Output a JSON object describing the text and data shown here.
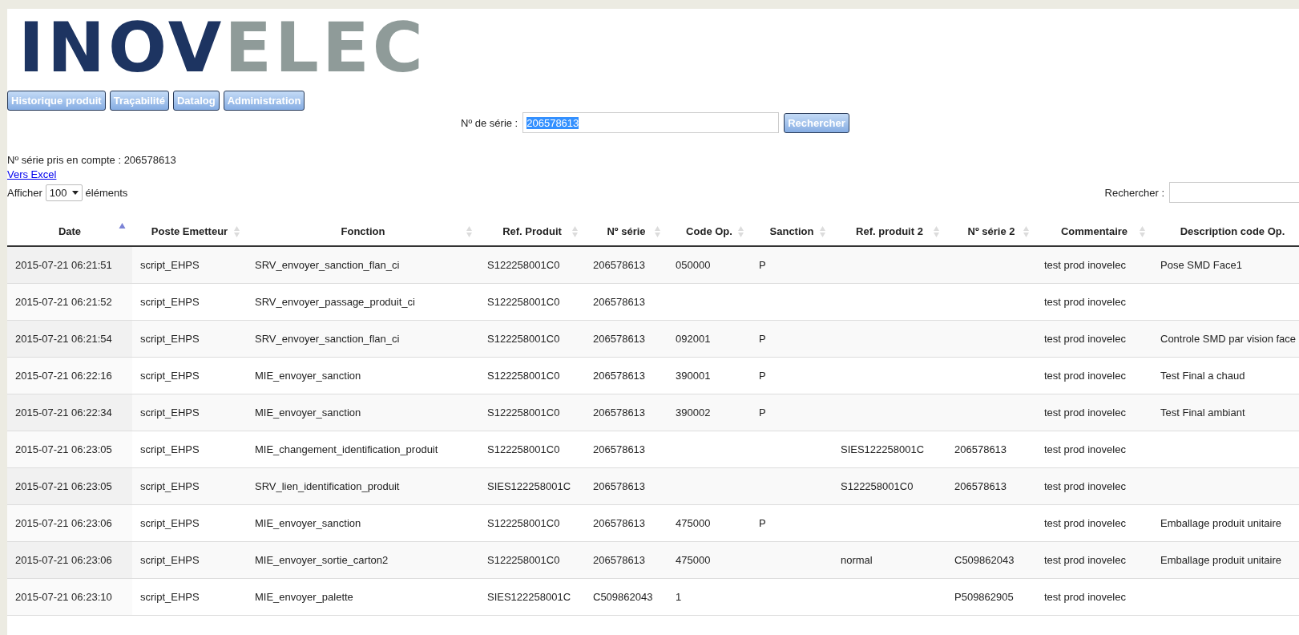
{
  "logo": {
    "first": "INOV",
    "second": "ELEC"
  },
  "nav_tabs": [
    {
      "label": "Historique produit"
    },
    {
      "label": "Traçabilité"
    },
    {
      "label": "Datalog"
    },
    {
      "label": "Administration"
    }
  ],
  "search": {
    "label": "Nº de série :",
    "value": "206578613",
    "value_selected": true,
    "button": "Rechercher"
  },
  "serial_info": "Nº série pris en compte : 206578613",
  "export_link": "Vers Excel",
  "page_length": {
    "prefix": "Afficher",
    "value": "100",
    "suffix": "éléments"
  },
  "filter": {
    "label": "Rechercher :"
  },
  "table": {
    "columns": [
      {
        "label": "Date",
        "sorted": true
      },
      {
        "label": "Poste Emetteur",
        "sorted": false
      },
      {
        "label": "Fonction",
        "sorted": false
      },
      {
        "label": "Ref. Produit",
        "sorted": false
      },
      {
        "label": "Nº série",
        "sorted": false
      },
      {
        "label": "Code Op.",
        "sorted": false
      },
      {
        "label": "Sanction",
        "sorted": false
      },
      {
        "label": "Ref. produit 2",
        "sorted": false
      },
      {
        "label": "Nº série 2",
        "sorted": false
      },
      {
        "label": "Commentaire",
        "sorted": false
      },
      {
        "label": "Description code Op."
      }
    ],
    "rows": [
      [
        "2015-07-21 06:21:51",
        "script_EHPS",
        "SRV_envoyer_sanction_flan_ci",
        "S122258001C0",
        "206578613",
        "050000",
        "P",
        null,
        null,
        "test prod inovelec",
        "Pose SMD Face1"
      ],
      [
        "2015-07-21 06:21:52",
        "script_EHPS",
        "SRV_envoyer_passage_produit_ci",
        "S122258001C0",
        "206578613",
        null,
        null,
        null,
        null,
        "test prod inovelec",
        null
      ],
      [
        "2015-07-21 06:21:54",
        "script_EHPS",
        "SRV_envoyer_sanction_flan_ci",
        "S122258001C0",
        "206578613",
        "092001",
        "P",
        null,
        null,
        "test prod inovelec",
        "Controle SMD par vision face"
      ],
      [
        "2015-07-21 06:22:16",
        "script_EHPS",
        "MIE_envoyer_sanction",
        "S122258001C0",
        "206578613",
        "390001",
        "P",
        null,
        null,
        "test prod inovelec",
        "Test Final a chaud"
      ],
      [
        "2015-07-21 06:22:34",
        "script_EHPS",
        "MIE_envoyer_sanction",
        "S122258001C0",
        "206578613",
        "390002",
        "P",
        null,
        null,
        "test prod inovelec",
        "Test Final ambiant"
      ],
      [
        "2015-07-21 06:23:05",
        "script_EHPS",
        "MIE_changement_identification_produit",
        "S122258001C0",
        "206578613",
        null,
        null,
        "SIES122258001C",
        "206578613",
        "test prod inovelec",
        null
      ],
      [
        "2015-07-21 06:23:05",
        "script_EHPS",
        "SRV_lien_identification_produit",
        "SIES122258001C",
        "206578613",
        null,
        null,
        "S122258001C0",
        "206578613",
        "test prod inovelec",
        null
      ],
      [
        "2015-07-21 06:23:06",
        "script_EHPS",
        "MIE_envoyer_sanction",
        "S122258001C0",
        "206578613",
        "475000",
        "P",
        null,
        null,
        "test prod inovelec",
        "Emballage produit unitaire"
      ],
      [
        "2015-07-21 06:23:06",
        "script_EHPS",
        "MIE_envoyer_sortie_carton2",
        "S122258001C0",
        "206578613",
        "475000",
        null,
        "normal",
        "C509862043",
        "test prod inovelec",
        "Emballage produit unitaire"
      ],
      [
        "2015-07-21 06:23:10",
        "script_EHPS",
        "MIE_envoyer_palette",
        "SIES122258001C",
        "C509862043",
        "1",
        null,
        null,
        "P509862905",
        "test prod inovelec",
        null
      ]
    ]
  }
}
